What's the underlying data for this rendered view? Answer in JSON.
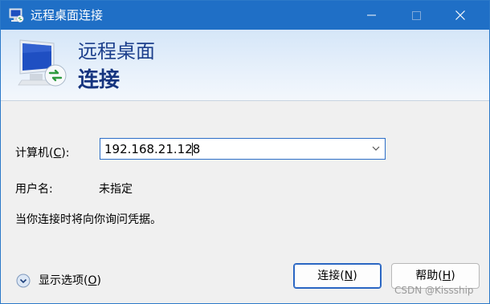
{
  "titlebar": {
    "title": "远程桌面连接",
    "icon": "remote-desktop-icon",
    "controls": [
      "minimize-icon",
      "maximize-icon",
      "close-icon"
    ]
  },
  "banner": {
    "line1": "远程桌面",
    "line2": "连接"
  },
  "form": {
    "computer": {
      "label_prefix": "计算机(",
      "label_key": "C",
      "label_suffix": "):",
      "value": "192.168.21.128"
    },
    "username": {
      "label": "用户名:",
      "value": "未指定"
    },
    "info_text": "当你连接时将向你询问凭据。"
  },
  "footer": {
    "options": {
      "label_prefix": "显示选项(",
      "label_key": "O",
      "label_suffix": ")",
      "icon": "expand-down-icon"
    },
    "connect_button": {
      "label_prefix": "连接(",
      "label_key": "N",
      "label_suffix": ")"
    },
    "help_button": {
      "label_prefix": "帮助(",
      "label_key": "H",
      "label_suffix": ")"
    }
  },
  "watermark": "CSDN @Kissship",
  "colors": {
    "titlebar": "#1f6fc6",
    "banner_text": "#1c3f8c",
    "focus_border": "#2a66c3"
  }
}
